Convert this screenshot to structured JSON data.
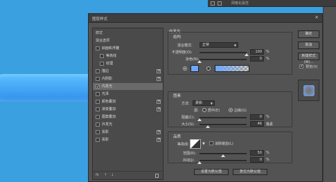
{
  "background": {
    "color": "#3aa0e0",
    "shape_color": "#3d9cf0"
  },
  "topbar": {
    "layer_label": "网格化属性"
  },
  "dialog": {
    "title": "图层样式",
    "styles_header": "样式",
    "blend_options": "混合选项",
    "items": [
      {
        "label": "斜面和浮雕",
        "checked": false,
        "indent": false,
        "plus": false
      },
      {
        "label": "等高线",
        "checked": false,
        "indent": true,
        "plus": false
      },
      {
        "label": "纹理",
        "checked": false,
        "indent": true,
        "plus": false
      },
      {
        "label": "描边",
        "checked": false,
        "indent": false,
        "plus": true
      },
      {
        "label": "内阴影",
        "checked": false,
        "indent": false,
        "plus": true
      },
      {
        "label": "内发光",
        "checked": true,
        "indent": false,
        "plus": false,
        "selected": true
      },
      {
        "label": "光泽",
        "checked": false,
        "indent": false,
        "plus": false
      },
      {
        "label": "颜色叠加",
        "checked": false,
        "indent": false,
        "plus": true
      },
      {
        "label": "渐变叠加",
        "checked": false,
        "indent": false,
        "plus": true
      },
      {
        "label": "图案叠加",
        "checked": false,
        "indent": false,
        "plus": false
      },
      {
        "label": "外发光",
        "checked": false,
        "indent": false,
        "plus": false
      },
      {
        "label": "投影",
        "checked": false,
        "indent": false,
        "plus": true
      },
      {
        "label": "投影",
        "checked": false,
        "indent": false,
        "plus": true
      }
    ],
    "bottom": {
      "fx": "fx",
      "up": "↑",
      "down": "↓"
    },
    "inner_glow": {
      "title": "内发光",
      "structure": {
        "title": "结构",
        "blend_mode_label": "混合模式:",
        "blend_mode_value": "正常",
        "opacity_label": "不透明度(O):",
        "opacity_value": "100",
        "opacity_percent": 100,
        "noise_label": "杂色(N):",
        "noise_value": "0",
        "noise_percent": 0,
        "unit": "%",
        "glow_color": "#6fa7ff"
      },
      "elements": {
        "title": "图素",
        "method_label": "方法:",
        "method_value": "柔和",
        "source_label": "源:",
        "center_label": "居中(E)",
        "edge_label": "边缘(G)",
        "choke_label": "阻塞(C):",
        "choke_value": "0",
        "choke_percent": 0,
        "size_label": "大小(S):",
        "size_value": "46",
        "size_percent": 0.18,
        "px_unit": "像素",
        "unit": "%"
      },
      "quality": {
        "title": "品质",
        "contour_label": "等高线:",
        "antialias_label": "消除锯齿(L)",
        "range_label": "范围(R):",
        "range_value": "50",
        "range_percent": 50,
        "jitter_label": "抖动(J):",
        "jitter_value": "0",
        "jitter_percent": 0,
        "unit": "%"
      },
      "set_default": "设置为默认值",
      "reset_default": "复位为默认值"
    },
    "buttons": {
      "ok": "确定",
      "cancel": "取消",
      "new_style": "新建样式(W)...",
      "preview": "预览(V)"
    }
  }
}
